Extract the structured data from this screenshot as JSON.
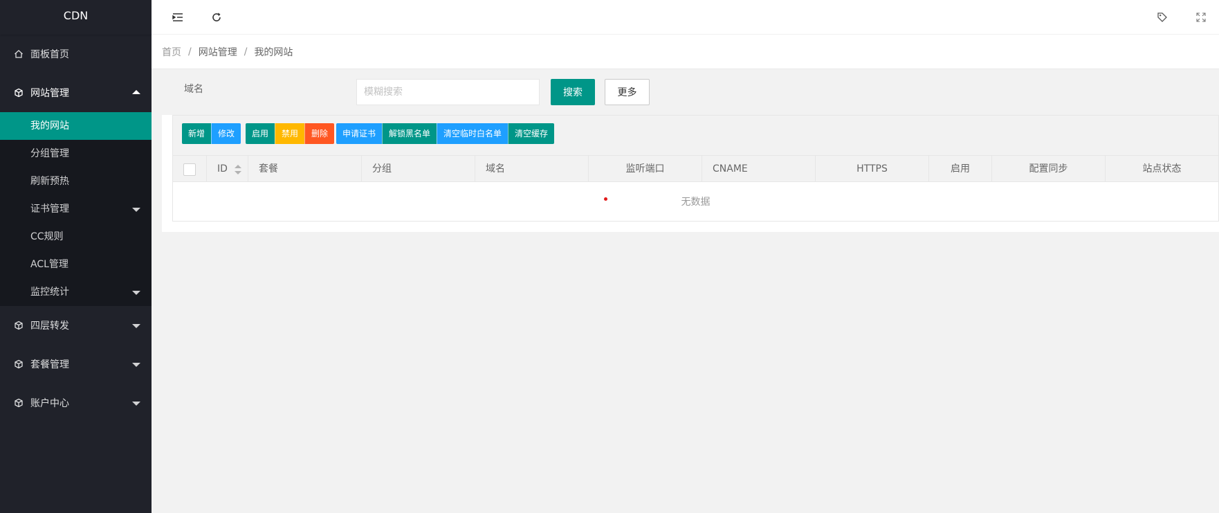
{
  "app": {
    "logo": "CDN"
  },
  "sidebar": {
    "items": [
      {
        "label": "面板首页",
        "icon": "home-icon"
      },
      {
        "label": "网站管理",
        "icon": "cube-icon",
        "open": true,
        "children": [
          {
            "label": "我的网站",
            "active": true
          },
          {
            "label": "分组管理"
          },
          {
            "label": "刷新预热"
          },
          {
            "label": "证书管理",
            "has_children": true
          },
          {
            "label": "CC规则"
          },
          {
            "label": "ACL管理"
          },
          {
            "label": "监控统计",
            "has_children": true
          }
        ]
      },
      {
        "label": "四层转发",
        "icon": "cube-icon"
      },
      {
        "label": "套餐管理",
        "icon": "cube-icon"
      },
      {
        "label": "账户中心",
        "icon": "cube-icon"
      }
    ]
  },
  "header": {
    "icons": [
      "menu-indent-icon",
      "refresh-icon",
      "tag-icon",
      "fullscreen-icon"
    ]
  },
  "breadcrumb": {
    "home": "首页",
    "level1": "网站管理",
    "level2": "我的网站"
  },
  "search": {
    "label": "域名",
    "placeholder": "模糊搜索",
    "search_button": "搜索",
    "more_button": "更多"
  },
  "toolbar": {
    "group1": {
      "add": "新增",
      "edit": "修改"
    },
    "group2": {
      "enable": "启用",
      "disable": "禁用",
      "delete": "删除"
    },
    "group3": {
      "apply_cert": "申请证书",
      "unlock_blacklist": "解锁黑名单",
      "clear_whitelist": "清空临时白名单",
      "clear_cache": "清空缓存"
    }
  },
  "table": {
    "columns": [
      "ID",
      "套餐",
      "分组",
      "域名",
      "监听端口",
      "CNAME",
      "HTTPS",
      "启用",
      "配置同步",
      "站点状态"
    ],
    "empty_text": "无数据"
  },
  "colors": {
    "primary": "#009688",
    "blue": "#1e9fff",
    "warn": "#ffb800",
    "danger": "#ff5722",
    "sidebar_bg": "#20222a"
  }
}
